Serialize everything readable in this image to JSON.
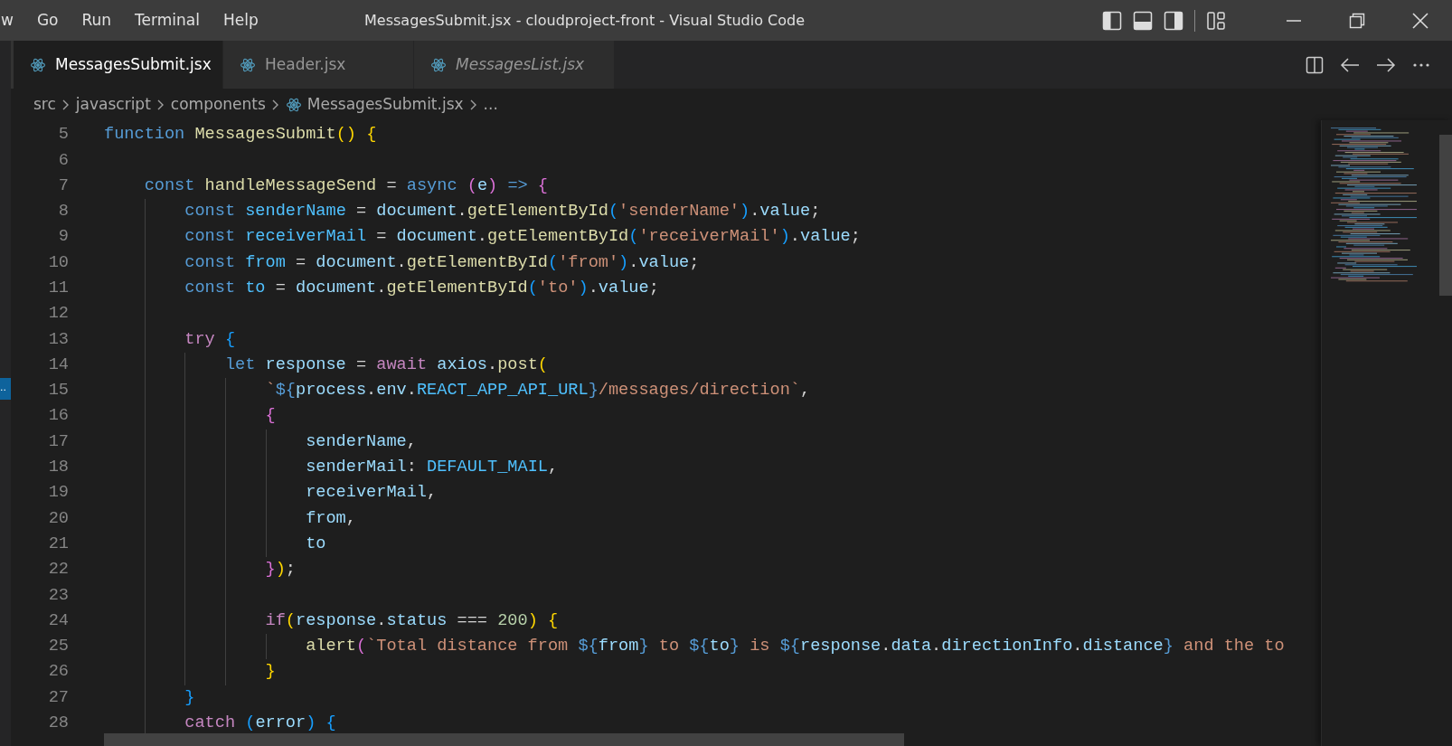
{
  "menu": [
    "w",
    "Go",
    "Run",
    "Terminal",
    "Help"
  ],
  "window": {
    "title": "MessagesSubmit.jsx - cloudproject-front - Visual Studio Code"
  },
  "tabs": [
    {
      "label": "MessagesSubmit.jsx",
      "selected": true,
      "preview": false
    },
    {
      "label": "Header.jsx",
      "selected": false,
      "preview": false
    },
    {
      "label": "MessagesList.jsx",
      "selected": false,
      "preview": true
    }
  ],
  "breadcrumb": [
    {
      "label": "src",
      "kind": "folder"
    },
    {
      "label": "javascript",
      "kind": "folder"
    },
    {
      "label": "components",
      "kind": "folder"
    },
    {
      "label": "MessagesSubmit.jsx",
      "kind": "file"
    },
    {
      "label": "...",
      "kind": "more"
    }
  ],
  "left_marker": "..",
  "code": [
    {
      "number": "5",
      "tokens": [
        {
          "text": "function ",
          "kind": "keyword"
        },
        {
          "text": "MessagesSubmit",
          "kind": "function"
        },
        {
          "text": "() ",
          "kind": "bracket1"
        },
        {
          "text": "{",
          "kind": "bracket1"
        }
      ],
      "children": [
        {
          "number": "6"
        },
        {
          "number": "7",
          "tokens": [
            {
              "text": "const ",
              "kind": "keyword"
            },
            {
              "text": "handleMessageSend",
              "kind": "function"
            },
            {
              "text": " = ",
              "kind": "operator"
            },
            {
              "text": "async ",
              "kind": "keyword"
            },
            {
              "text": "(",
              "kind": "bracket2"
            },
            {
              "text": "e",
              "kind": "variable"
            },
            {
              "text": ") ",
              "kind": "bracket2"
            },
            {
              "text": "=> ",
              "kind": "keyword"
            },
            {
              "text": "{",
              "kind": "bracket2"
            }
          ],
          "children": [
            {
              "number": "8",
              "tokens": [
                {
                  "text": "const ",
                  "kind": "keyword"
                },
                {
                  "text": "senderName",
                  "kind": "constant"
                },
                {
                  "text": " = ",
                  "kind": "operator"
                },
                {
                  "text": "document",
                  "kind": "variable"
                },
                {
                  "text": ".",
                  "kind": "operator"
                },
                {
                  "text": "getElementById",
                  "kind": "function"
                },
                {
                  "text": "(",
                  "kind": "bracket3"
                },
                {
                  "text": "'senderName'",
                  "kind": "string"
                },
                {
                  "text": ")",
                  "kind": "bracket3"
                },
                {
                  "text": ".",
                  "kind": "operator"
                },
                {
                  "text": "value",
                  "kind": "variable"
                },
                {
                  "text": ";",
                  "kind": "operator"
                }
              ]
            },
            {
              "number": "9",
              "tokens": [
                {
                  "text": "const ",
                  "kind": "keyword"
                },
                {
                  "text": "receiverMail",
                  "kind": "constant"
                },
                {
                  "text": " = ",
                  "kind": "operator"
                },
                {
                  "text": "document",
                  "kind": "variable"
                },
                {
                  "text": ".",
                  "kind": "operator"
                },
                {
                  "text": "getElementById",
                  "kind": "function"
                },
                {
                  "text": "(",
                  "kind": "bracket3"
                },
                {
                  "text": "'receiverMail'",
                  "kind": "string"
                },
                {
                  "text": ")",
                  "kind": "bracket3"
                },
                {
                  "text": ".",
                  "kind": "operator"
                },
                {
                  "text": "value",
                  "kind": "variable"
                },
                {
                  "text": ";",
                  "kind": "operator"
                }
              ]
            },
            {
              "number": "10",
              "tokens": [
                {
                  "text": "const ",
                  "kind": "keyword"
                },
                {
                  "text": "from",
                  "kind": "constant"
                },
                {
                  "text": " = ",
                  "kind": "operator"
                },
                {
                  "text": "document",
                  "kind": "variable"
                },
                {
                  "text": ".",
                  "kind": "operator"
                },
                {
                  "text": "getElementById",
                  "kind": "function"
                },
                {
                  "text": "(",
                  "kind": "bracket3"
                },
                {
                  "text": "'from'",
                  "kind": "string"
                },
                {
                  "text": ")",
                  "kind": "bracket3"
                },
                {
                  "text": ".",
                  "kind": "operator"
                },
                {
                  "text": "value",
                  "kind": "variable"
                },
                {
                  "text": ";",
                  "kind": "operator"
                }
              ]
            },
            {
              "number": "11",
              "tokens": [
                {
                  "text": "const ",
                  "kind": "keyword"
                },
                {
                  "text": "to",
                  "kind": "constant"
                },
                {
                  "text": " = ",
                  "kind": "operator"
                },
                {
                  "text": "document",
                  "kind": "variable"
                },
                {
                  "text": ".",
                  "kind": "operator"
                },
                {
                  "text": "getElementById",
                  "kind": "function"
                },
                {
                  "text": "(",
                  "kind": "bracket3"
                },
                {
                  "text": "'to'",
                  "kind": "string"
                },
                {
                  "text": ")",
                  "kind": "bracket3"
                },
                {
                  "text": ".",
                  "kind": "operator"
                },
                {
                  "text": "value",
                  "kind": "variable"
                },
                {
                  "text": ";",
                  "kind": "operator"
                }
              ]
            },
            {
              "number": "12"
            },
            {
              "number": "13",
              "tokens": [
                {
                  "text": "try ",
                  "kind": "control"
                },
                {
                  "text": "{",
                  "kind": "bracket3"
                }
              ],
              "children": [
                {
                  "number": "14",
                  "tokens": [
                    {
                      "text": "let ",
                      "kind": "keyword"
                    },
                    {
                      "text": "response",
                      "kind": "variable"
                    },
                    {
                      "text": " = ",
                      "kind": "operator"
                    },
                    {
                      "text": "await ",
                      "kind": "control"
                    },
                    {
                      "text": "axios",
                      "kind": "variable"
                    },
                    {
                      "text": ".",
                      "kind": "operator"
                    },
                    {
                      "text": "post",
                      "kind": "function"
                    },
                    {
                      "text": "(",
                      "kind": "bracket1"
                    }
                  ],
                  "children": [
                    {
                      "number": "15",
                      "tokens": [
                        {
                          "text": "`",
                          "kind": "string"
                        },
                        {
                          "text": "${",
                          "kind": "keyword"
                        },
                        {
                          "text": "process",
                          "kind": "variable"
                        },
                        {
                          "text": ".",
                          "kind": "operator"
                        },
                        {
                          "text": "env",
                          "kind": "variable"
                        },
                        {
                          "text": ".",
                          "kind": "operator"
                        },
                        {
                          "text": "REACT_APP_API_URL",
                          "kind": "constant"
                        },
                        {
                          "text": "}",
                          "kind": "keyword"
                        },
                        {
                          "text": "/messages/direction`",
                          "kind": "string"
                        },
                        {
                          "text": ",",
                          "kind": "operator"
                        }
                      ]
                    },
                    {
                      "number": "16",
                      "tokens": [
                        {
                          "text": "{",
                          "kind": "bracket2"
                        }
                      ],
                      "children": [
                        {
                          "number": "17",
                          "tokens": [
                            {
                              "text": "senderName",
                              "kind": "variable"
                            },
                            {
                              "text": ",",
                              "kind": "operator"
                            }
                          ]
                        },
                        {
                          "number": "18",
                          "tokens": [
                            {
                              "text": "senderMail",
                              "kind": "variable"
                            },
                            {
                              "text": ": ",
                              "kind": "operator"
                            },
                            {
                              "text": "DEFAULT_MAIL",
                              "kind": "constant"
                            },
                            {
                              "text": ",",
                              "kind": "operator"
                            }
                          ]
                        },
                        {
                          "number": "19",
                          "tokens": [
                            {
                              "text": "receiverMail",
                              "kind": "variable"
                            },
                            {
                              "text": ",",
                              "kind": "operator"
                            }
                          ]
                        },
                        {
                          "number": "20",
                          "tokens": [
                            {
                              "text": "from",
                              "kind": "variable"
                            },
                            {
                              "text": ",",
                              "kind": "operator"
                            }
                          ]
                        },
                        {
                          "number": "21",
                          "tokens": [
                            {
                              "text": "to",
                              "kind": "variable"
                            }
                          ]
                        }
                      ]
                    },
                    {
                      "number": "22",
                      "tokens": [
                        {
                          "text": "}",
                          "kind": "bracket2"
                        },
                        {
                          "text": ")",
                          "kind": "bracket1"
                        },
                        {
                          "text": ";",
                          "kind": "operator"
                        }
                      ]
                    },
                    {
                      "number": "23"
                    },
                    {
                      "number": "24",
                      "tokens": [
                        {
                          "text": "if",
                          "kind": "control"
                        },
                        {
                          "text": "(",
                          "kind": "bracket1"
                        },
                        {
                          "text": "response",
                          "kind": "variable"
                        },
                        {
                          "text": ".",
                          "kind": "operator"
                        },
                        {
                          "text": "status",
                          "kind": "variable"
                        },
                        {
                          "text": " === ",
                          "kind": "operator"
                        },
                        {
                          "text": "200",
                          "kind": "number"
                        },
                        {
                          "text": ") ",
                          "kind": "bracket1"
                        },
                        {
                          "text": "{",
                          "kind": "bracket1"
                        }
                      ],
                      "children": [
                        {
                          "number": "25",
                          "tokens": [
                            {
                              "text": "alert",
                              "kind": "function"
                            },
                            {
                              "text": "(",
                              "kind": "bracket2"
                            },
                            {
                              "text": "`Total distance from ",
                              "kind": "string"
                            },
                            {
                              "text": "${",
                              "kind": "keyword"
                            },
                            {
                              "text": "from",
                              "kind": "variable"
                            },
                            {
                              "text": "}",
                              "kind": "keyword"
                            },
                            {
                              "text": " to ",
                              "kind": "string"
                            },
                            {
                              "text": "${",
                              "kind": "keyword"
                            },
                            {
                              "text": "to",
                              "kind": "variable"
                            },
                            {
                              "text": "}",
                              "kind": "keyword"
                            },
                            {
                              "text": " is ",
                              "kind": "string"
                            },
                            {
                              "text": "${",
                              "kind": "keyword"
                            },
                            {
                              "text": "response",
                              "kind": "variable"
                            },
                            {
                              "text": ".",
                              "kind": "operator"
                            },
                            {
                              "text": "data",
                              "kind": "variable"
                            },
                            {
                              "text": ".",
                              "kind": "operator"
                            },
                            {
                              "text": "directionInfo",
                              "kind": "variable"
                            },
                            {
                              "text": ".",
                              "kind": "operator"
                            },
                            {
                              "text": "distance",
                              "kind": "variable"
                            },
                            {
                              "text": "}",
                              "kind": "keyword"
                            },
                            {
                              "text": " and the to",
                              "kind": "string"
                            }
                          ]
                        }
                      ]
                    },
                    {
                      "number": "26",
                      "tokens": [
                        {
                          "text": "}",
                          "kind": "bracket1"
                        }
                      ]
                    }
                  ]
                }
              ]
            },
            {
              "number": "27",
              "tokens": [
                {
                  "text": "}",
                  "kind": "bracket3"
                }
              ]
            },
            {
              "number": "28",
              "tokens": [
                {
                  "text": "catch ",
                  "kind": "control"
                },
                {
                  "text": "(",
                  "kind": "bracket3"
                },
                {
                  "text": "error",
                  "kind": "variable"
                },
                {
                  "text": ") ",
                  "kind": "bracket3"
                },
                {
                  "text": "{",
                  "kind": "bracket3"
                }
              ]
            }
          ]
        }
      ]
    }
  ]
}
